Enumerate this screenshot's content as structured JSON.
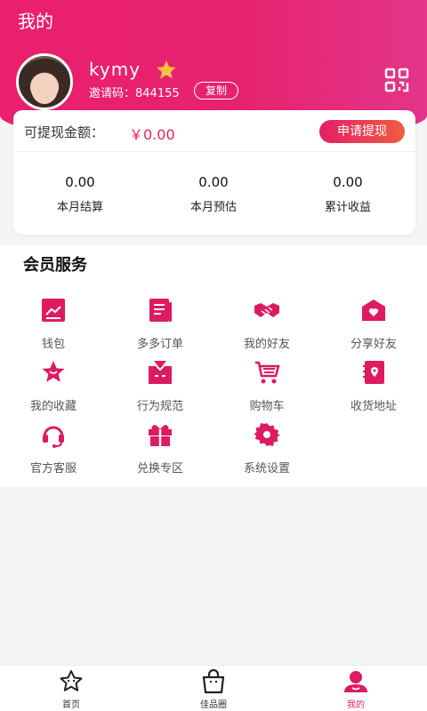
{
  "header": {
    "title": "我的",
    "username": "kymy",
    "invite_text": "邀请码：844155",
    "copy_label": "复制"
  },
  "wallet": {
    "withdrawable_label": "可提现金额：",
    "withdrawable_value": "￥0.00",
    "withdraw_button": "申请提现",
    "stats": [
      {
        "value": "0.00",
        "label": "本月结算"
      },
      {
        "value": "0.00",
        "label": "本月预估"
      },
      {
        "value": "0.00",
        "label": "累计收益"
      }
    ]
  },
  "services": {
    "title": "会员服务",
    "items": [
      {
        "label": "钱包",
        "icon": "wallet-icon"
      },
      {
        "label": "多多订单",
        "icon": "orders-icon"
      },
      {
        "label": "我的好友",
        "icon": "handshake-icon"
      },
      {
        "label": "分享好友",
        "icon": "share-icon"
      },
      {
        "label": "我的收藏",
        "icon": "star-icon"
      },
      {
        "label": "行为规范",
        "icon": "rules-icon"
      },
      {
        "label": "购物车",
        "icon": "cart-icon"
      },
      {
        "label": "收货地址",
        "icon": "address-book-icon"
      },
      {
        "label": "官方客服",
        "icon": "headset-icon"
      },
      {
        "label": "兑换专区",
        "icon": "gift-icon"
      },
      {
        "label": "系统设置",
        "icon": "gear-icon"
      }
    ]
  },
  "tabbar": {
    "tabs": [
      {
        "label": "首页",
        "icon": "home-icon"
      },
      {
        "label": "佳品圈",
        "icon": "shopping-bag-icon"
      },
      {
        "label": "我的",
        "icon": "profile-icon"
      }
    ],
    "active_index": 2
  },
  "colors": {
    "accent": "#e6226f",
    "button_gradient_end": "#f05c43",
    "background": "#f5f5f5"
  }
}
